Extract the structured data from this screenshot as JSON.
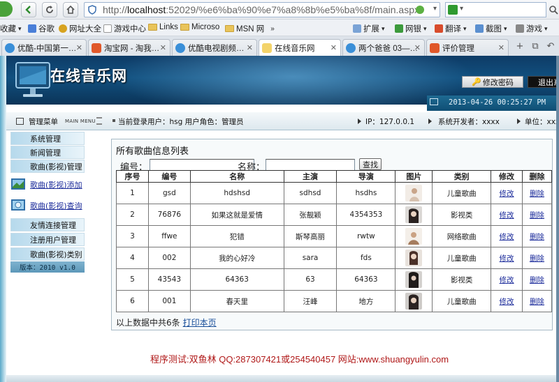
{
  "browser": {
    "url_dim_prefix": "http://",
    "url_host": "localhost",
    "url_rest": ":52029/%e6%ba%90%e7%a8%8b%e5%ba%8f/main.aspx",
    "favorites": [
      {
        "label": "收藏",
        "icon": "star-icon"
      },
      {
        "label": "谷歌",
        "icon": "google-icon"
      },
      {
        "label": "网址大全",
        "icon": "globe-icon"
      },
      {
        "label": "游戏中心",
        "icon": "page-icon"
      },
      {
        "label": "Links",
        "icon": "folder-icon"
      },
      {
        "label": "Microso",
        "icon": "folder-icon"
      },
      {
        "label": "MSN 网",
        "icon": "folder-icon"
      },
      {
        "label": "扩展",
        "icon": "grid-icon"
      },
      {
        "label": "网银",
        "icon": "shield-icon"
      },
      {
        "label": "翻译",
        "icon": "translate-icon"
      },
      {
        "label": "截图",
        "icon": "scissors-icon"
      },
      {
        "label": "游戏",
        "icon": "gamepad-icon"
      }
    ],
    "tabs": [
      {
        "label": "优酷-中国第一…",
        "active": false
      },
      {
        "label": "淘宝网 - 淘我…",
        "active": false
      },
      {
        "label": "优酷电视剧频…",
        "active": false
      },
      {
        "label": "在线音乐网",
        "active": true
      },
      {
        "label": "两个爸爸 03—…",
        "active": false
      },
      {
        "label": "评价管理",
        "active": false
      }
    ],
    "colors": {
      "accent": "#4aa23a",
      "url_border": "#9fb4cf"
    }
  },
  "site": {
    "title": "在线音乐网",
    "change_password": "修改密码",
    "logout": "退出系统",
    "datetime": "2013-04-26 00:25:27 PM"
  },
  "infobar": {
    "menu_title": "管理菜单",
    "menu_title_en": "MAIN MENU",
    "current_user": "当前登录用户：hsg  用户角色：管理员",
    "ip": "IP：127.0.0.1",
    "developer": "系统开发者：xxxx",
    "unit": "单位：xxxx"
  },
  "sidebar": {
    "group1": [
      "系统管理",
      "新闻管理",
      "歌曲(影视)管理"
    ],
    "links": [
      "歌曲(影视)添加",
      "歌曲(影视)查询"
    ],
    "group2": [
      "友情连接管理",
      "注册用户管理",
      "歌曲(影视)类别"
    ],
    "version": "版本：2010 v1.0"
  },
  "main": {
    "title": "所有歌曲信息列表",
    "search": {
      "code_label": "编号：",
      "name_label": "名称：",
      "button": "查找",
      "code_value": "",
      "name_value": ""
    },
    "columns": [
      "序号",
      "编号",
      "名称",
      "主演",
      "导演",
      "图片",
      "类别",
      "修改",
      "删除"
    ],
    "rows": [
      {
        "seq": "1",
        "code": "gsd",
        "name": "hdshsd",
        "actor": "sdhsd",
        "director": "hsdhs",
        "category": "儿童歌曲"
      },
      {
        "seq": "2",
        "code": "76876",
        "name": "如果这就是爱情",
        "actor": "张靓颖",
        "director": "4354353",
        "category": "影视类"
      },
      {
        "seq": "3",
        "code": "ffwe",
        "name": "犯错",
        "actor": "斯琴高丽",
        "director": "rwtw",
        "category": "网络歌曲"
      },
      {
        "seq": "4",
        "code": "002",
        "name": "我的心好冷",
        "actor": "sara",
        "director": "fds",
        "category": "儿童歌曲"
      },
      {
        "seq": "5",
        "code": "43543",
        "name": "64363",
        "actor": "63",
        "director": "64363",
        "category": "影视类"
      },
      {
        "seq": "6",
        "code": "001",
        "name": "春天里",
        "actor": "汪峰",
        "director": "地方",
        "category": "儿童歌曲"
      }
    ],
    "edit_label": "修改",
    "delete_label": "删除",
    "footer_text": "以上数据中共6条",
    "print_label": "打印本页"
  },
  "credit": "程序测试:双鱼林 QQ:287307421或254540457 网站:www.shuangyulin.com"
}
